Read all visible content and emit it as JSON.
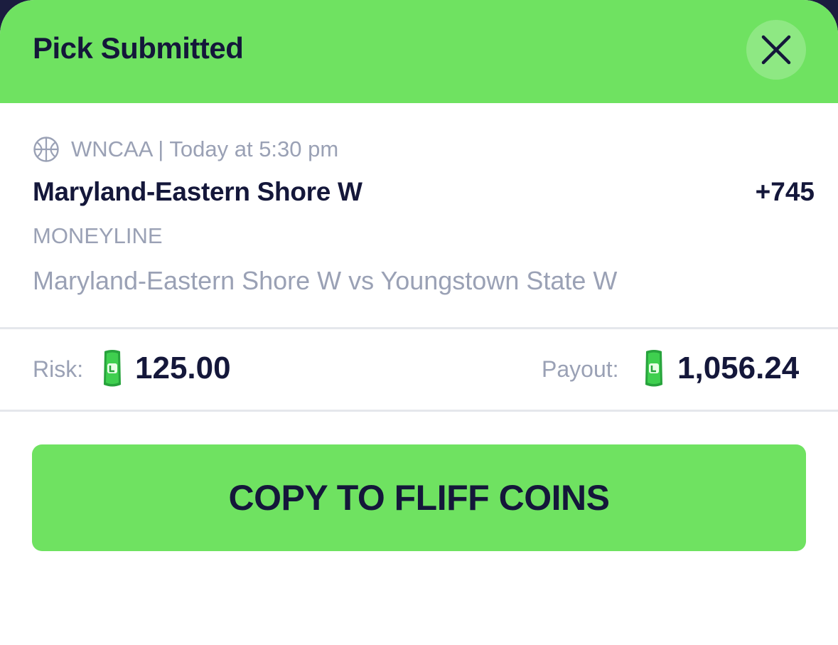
{
  "header": {
    "title": "Pick Submitted",
    "close_icon": "close-icon"
  },
  "pick": {
    "league_icon": "basketball-icon",
    "league_time": "WNCAA | Today at 5:30 pm",
    "team": "Maryland-Eastern Shore W",
    "odds": "+745",
    "bet_type": "MONEYLINE",
    "matchup": "Maryland-Eastern Shore W vs Youngstown State W"
  },
  "wager": {
    "risk_label": "Risk:",
    "risk_value": "125.00",
    "payout_label": "Payout:",
    "payout_value": "1,056.24",
    "coin_icon": "cash-coin-icon"
  },
  "action": {
    "copy_label": "COPY TO FLIFF COINS"
  },
  "colors": {
    "accent_green": "#6fe261",
    "text_dark": "#14173a",
    "text_muted": "#9aa1b5",
    "backdrop": "#1b1d3f"
  }
}
